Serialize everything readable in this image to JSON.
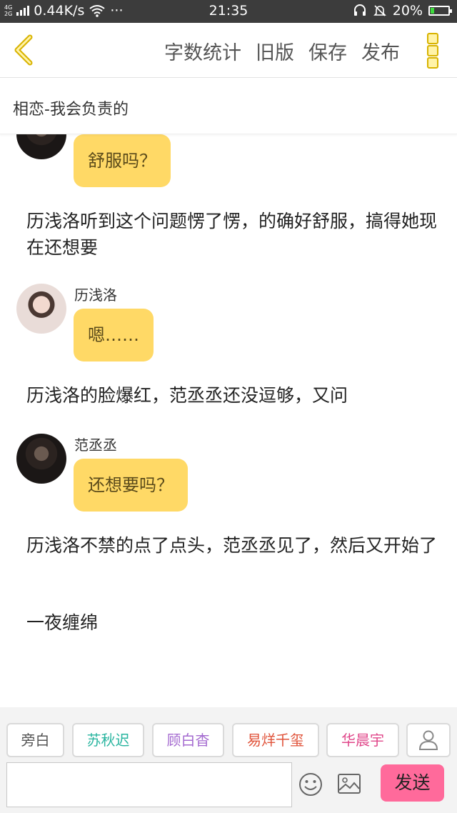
{
  "status_bar": {
    "network_type": "4G",
    "network_type_2": "2G",
    "speed": "0.44K/s",
    "dots": "···",
    "time": "21:35",
    "battery": "20%",
    "battery_level": 0.2
  },
  "header": {
    "actions": [
      "字数统计",
      "旧版",
      "保存",
      "发布"
    ]
  },
  "story": {
    "title": "相恋-我会负责的"
  },
  "messages": [
    {
      "type": "dialogue",
      "avatar": "male",
      "speaker": "",
      "text": "舒服吗？"
    },
    {
      "type": "narration",
      "text": "历浅洛听到这个问题愣了愣，的确好舒服，搞得她现在还想要"
    },
    {
      "type": "dialogue",
      "avatar": "female",
      "speaker": "历浅洛",
      "text": "嗯……"
    },
    {
      "type": "narration",
      "text": "历浅洛的脸爆红，范丞丞还没逗够，又问"
    },
    {
      "type": "dialogue",
      "avatar": "male",
      "speaker": "范丞丞",
      "text": "还想要吗？"
    },
    {
      "type": "narration",
      "text": "历浅洛不禁的点了点头，范丞丞见了，然后又开始了"
    },
    {
      "type": "narration",
      "text": "一夜缠绵"
    }
  ],
  "characters": [
    {
      "name": "旁白",
      "color": "#555555"
    },
    {
      "name": "苏秋迟",
      "color": "#2ab5a0"
    },
    {
      "name": "顾白杳",
      "color": "#a46ad0"
    },
    {
      "name": "易烊千玺",
      "color": "#e0533a"
    },
    {
      "name": "华晨宇",
      "color": "#e0478a"
    }
  ],
  "input": {
    "value": "",
    "placeholder": ""
  },
  "send_label": "发送",
  "icons": {
    "back": "chevron-left-icon",
    "more": "more-vertical-icon",
    "add_character": "user-icon",
    "emoji": "smiley-icon",
    "image": "image-icon"
  },
  "colors": {
    "accent": "#ffd966",
    "send": "#ff6a9b",
    "icon_accent": "#d8b300"
  }
}
